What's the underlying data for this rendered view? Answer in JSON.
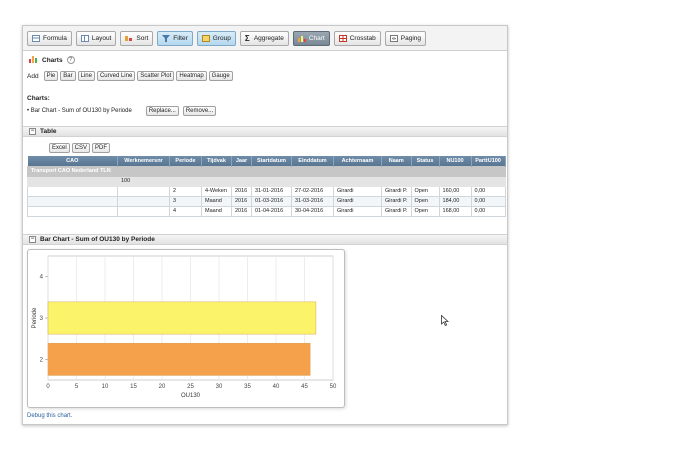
{
  "toolbar": {
    "buttons": [
      {
        "label": "Formula",
        "icon": "table-icon"
      },
      {
        "label": "Layout",
        "icon": "layout-icon"
      },
      {
        "label": "Sort",
        "icon": "sort-icon"
      },
      {
        "label": "Filter",
        "icon": "filter-icon"
      },
      {
        "label": "Group",
        "icon": "group-icon"
      },
      {
        "label": "Aggregate",
        "icon": "sigma-icon"
      },
      {
        "label": "Chart",
        "icon": "chart-icon"
      },
      {
        "label": "Crosstab",
        "icon": "crosstab-icon"
      },
      {
        "label": "Paging",
        "icon": "paging-icon"
      }
    ]
  },
  "charts_section": {
    "title": "Charts",
    "help": "?",
    "add_label": "Add",
    "chart_types": [
      "Pie",
      "Bar",
      "Line",
      "Curved Line",
      "Scatter Plot",
      "Heatmap",
      "Gauge"
    ],
    "list_label": "Charts:",
    "chart_item": "• Bar Chart - Sum of OU130 by Periode",
    "replace_label": "Replace...",
    "remove_label": "Remove..."
  },
  "table_section": {
    "title": "Table",
    "export_buttons": [
      "Excel",
      "CSV",
      "PDF"
    ],
    "columns": [
      "CAO",
      "Werknemersnr",
      "Periode",
      "Tijdvak",
      "Jaar",
      "Startdatum",
      "Einddatum",
      "Achternaam",
      "Naam",
      "Status",
      "NU100",
      "ParttU100"
    ],
    "group_label": "Transport CAO Nederland TLN",
    "subgroup_label": "100",
    "rows": [
      [
        "",
        "",
        "2",
        "4-Weken",
        "2016",
        "31-01-2016",
        "27-02-2016",
        "Girardi",
        "Girardi P.",
        "Open",
        "160,00",
        "0,00"
      ],
      [
        "",
        "",
        "3",
        "Maand",
        "2016",
        "01-03-2016",
        "31-03-2016",
        "Girardi",
        "Girardi P.",
        "Open",
        "184,00",
        "0,00"
      ],
      [
        "",
        "",
        "4",
        "Maand",
        "2016",
        "01-04-2016",
        "30-04-2016",
        "Girardi",
        "Girardi P.",
        "Open",
        "168,00",
        "0,00"
      ]
    ]
  },
  "chart_section": {
    "title": "Bar Chart - Sum of OU130 by Periode",
    "debug_link": "Debug this chart."
  },
  "chart_data": {
    "type": "bar",
    "orientation": "horizontal",
    "categories": [
      "2",
      "3",
      "4"
    ],
    "values": [
      46,
      47,
      0
    ],
    "colors": [
      "#f5a04a",
      "#fbf46a",
      "#ffffff"
    ],
    "xlabel": "OU130",
    "ylabel": "Periode",
    "xlim": [
      0,
      50
    ],
    "xticks": [
      0,
      5,
      10,
      15,
      20,
      25,
      30,
      35,
      40,
      45,
      50
    ],
    "grid": true
  }
}
